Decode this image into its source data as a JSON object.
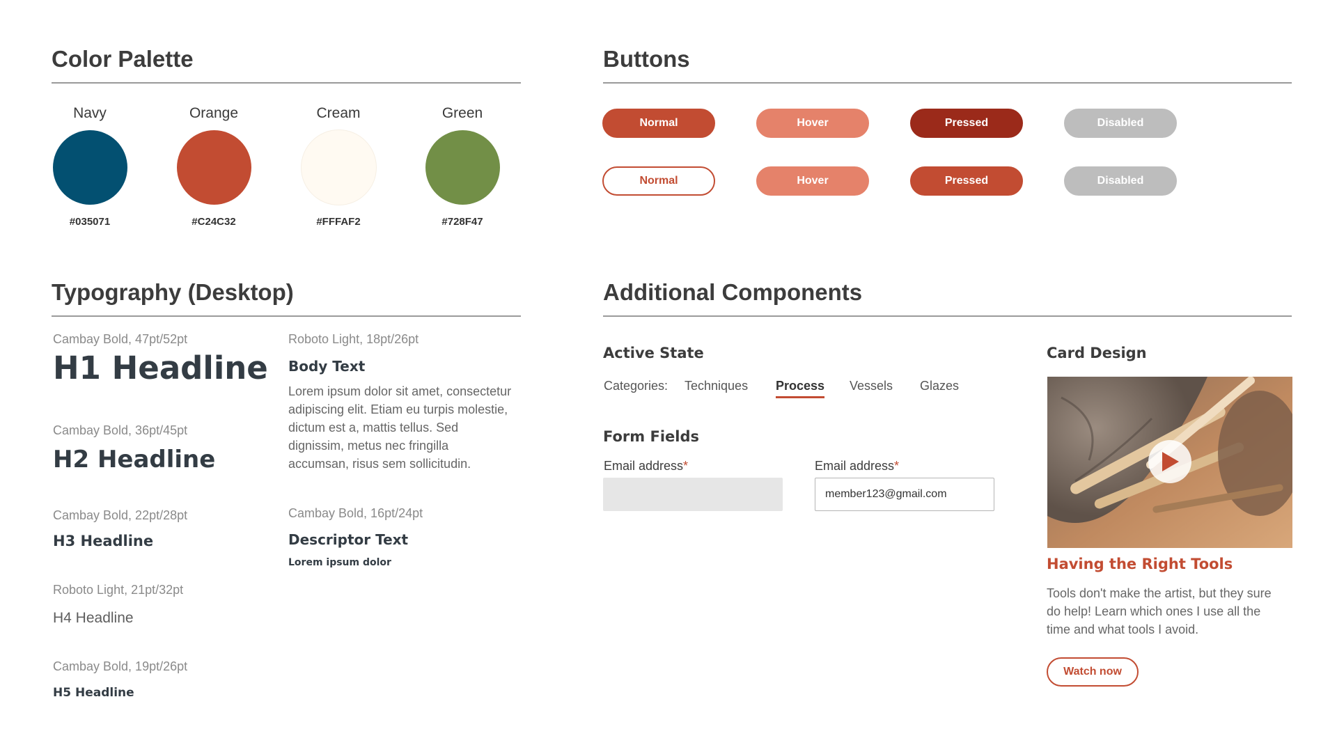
{
  "color_palette": {
    "title": "Color Palette",
    "swatches": [
      {
        "name": "Navy",
        "hex": "#035071",
        "color": "#035071"
      },
      {
        "name": "Orange",
        "hex": "#C24C32",
        "color": "#C24C32"
      },
      {
        "name": "Cream",
        "hex": "#FFFAF2",
        "color": "#FFFAF2"
      },
      {
        "name": "Green",
        "hex": "#728F47",
        "color": "#728F47"
      }
    ]
  },
  "buttons": {
    "title": "Buttons",
    "row1": [
      {
        "label": "Normal",
        "state": "normal",
        "style": "filled",
        "bg": "#C24C32"
      },
      {
        "label": "Hover",
        "state": "hover",
        "style": "filled",
        "bg": "#E5826A"
      },
      {
        "label": "Pressed",
        "state": "pressed",
        "style": "filled",
        "bg": "#9B2A1A"
      },
      {
        "label": "Disabled",
        "state": "disabled",
        "style": "filled",
        "bg": "#BDBDBD"
      }
    ],
    "row2": [
      {
        "label": "Normal",
        "state": "normal",
        "style": "outline",
        "bg": "#FFFFFF"
      },
      {
        "label": "Hover",
        "state": "hover",
        "style": "filled",
        "bg": "#E5826A"
      },
      {
        "label": "Pressed",
        "state": "pressed",
        "style": "filled",
        "bg": "#C24C32"
      },
      {
        "label": "Disabled",
        "state": "disabled",
        "style": "filled",
        "bg": "#BDBDBD"
      }
    ]
  },
  "typography": {
    "title": "Typography (Desktop)",
    "h1": {
      "meta": "Cambay Bold, 47pt/52pt",
      "text": "H1 Headline"
    },
    "h2": {
      "meta": "Cambay Bold, 36pt/45pt",
      "text": "H2 Headline"
    },
    "h3": {
      "meta": "Cambay Bold, 22pt/28pt",
      "text": "H3 Headline"
    },
    "h4": {
      "meta": "Roboto Light, 21pt/32pt",
      "text": "H4 Headline"
    },
    "h5": {
      "meta": "Cambay Bold, 19pt/26pt",
      "text": "H5 Headline"
    },
    "body": {
      "meta": "Roboto Light, 18pt/26pt",
      "heading": "Body Text",
      "lines": [
        "Lorem ipsum dolor sit amet, consectetur",
        "adipiscing elit. Etiam eu turpis molestie,",
        "dictum est a, mattis tellus. Sed",
        "dignissim, metus nec fringilla",
        "accumsan, risus sem sollicitudin."
      ]
    },
    "descriptor": {
      "meta": "Cambay Bold, 16pt/24pt",
      "heading": "Descriptor Text",
      "sample": "Lorem ipsum dolor"
    }
  },
  "components": {
    "title": "Additional Components",
    "active_state": {
      "title": "Active State",
      "label": "Categories:",
      "items": [
        "Techniques",
        "Process",
        "Vessels",
        "Glazes"
      ],
      "active": "Process"
    },
    "form_fields": {
      "title": "Form Fields",
      "fields": [
        {
          "label": "Email address",
          "required_mark": "*",
          "value": "",
          "placeholder": ""
        },
        {
          "label": "Email address",
          "required_mark": "*",
          "value": "member123@gmail.com",
          "placeholder": ""
        }
      ]
    },
    "card": {
      "section_title": "Card Design",
      "image_icon": "play-icon",
      "title": "Having the Right Tools",
      "lines": [
        "Tools don't make the artist, but they sure",
        "do help! Learn which ones I use all the",
        "time and what tools I avoid."
      ],
      "button_label": "Watch now"
    }
  },
  "colors": {
    "accent": "#C24C32",
    "text_dark": "#3C3C3C",
    "muted": "#8A8A8A",
    "rule": "#9A9A9A"
  }
}
